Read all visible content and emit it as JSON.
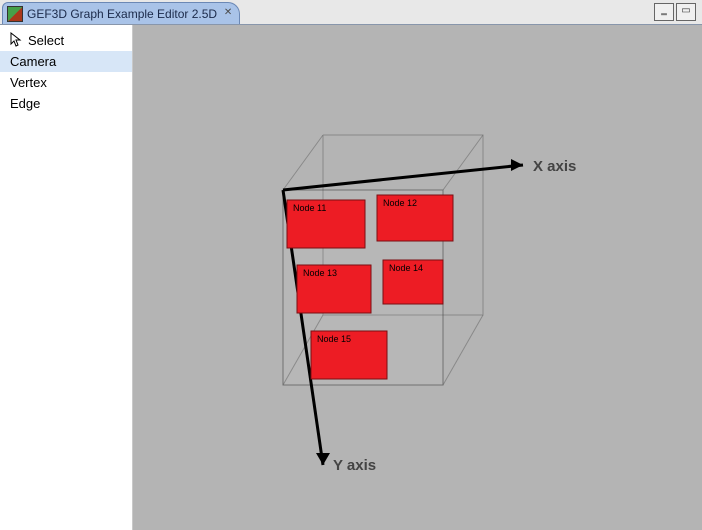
{
  "titlebar": {
    "title": "GEF3D Graph Example Editor 2.5D"
  },
  "palette": {
    "items": [
      {
        "label": "Select",
        "selected": false,
        "hasCursorIcon": true
      },
      {
        "label": "Camera",
        "selected": true,
        "hasCursorIcon": false
      },
      {
        "label": "Vertex",
        "selected": false,
        "hasCursorIcon": false
      },
      {
        "label": "Edge",
        "selected": false,
        "hasCursorIcon": false
      }
    ]
  },
  "axes": {
    "x_label": "X axis",
    "y_label": "Y axis"
  },
  "nodes": [
    {
      "label": "Node 11"
    },
    {
      "label": "Node 12"
    },
    {
      "label": "Node 13"
    },
    {
      "label": "Node 14"
    },
    {
      "label": "Node 15"
    }
  ],
  "colors": {
    "node_fill": "#ed1c24",
    "canvas_bg": "#b4b4b4",
    "tab_bg": "#a9c3e8"
  }
}
